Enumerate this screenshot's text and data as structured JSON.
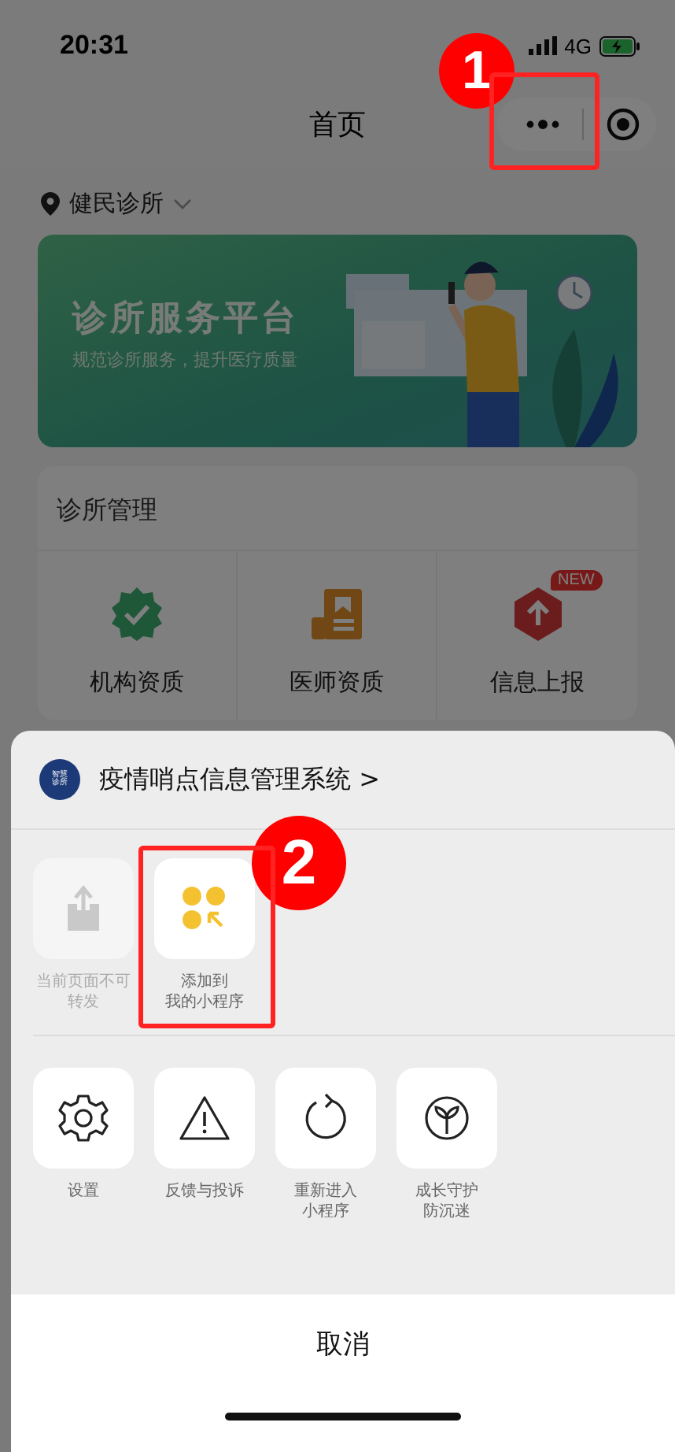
{
  "status_bar": {
    "time": "20:31",
    "network": "4G"
  },
  "nav_bar": {
    "title": "首页"
  },
  "location": {
    "name": "健民诊所"
  },
  "banner": {
    "title": "诊所服务平台",
    "subtitle": "规范诊所服务，提升医疗质量"
  },
  "clinic_card": {
    "title": "诊所管理",
    "items": [
      {
        "kind": "verify",
        "label": "机构资质"
      },
      {
        "kind": "doctor",
        "label": "医师资质"
      },
      {
        "kind": "report",
        "label": "信息上报",
        "badge": "NEW"
      }
    ]
  },
  "sheet": {
    "app_name": "疫情哨点信息管理系统",
    "app_arrow": ">",
    "logo_text": [
      "智慧",
      "诊所"
    ],
    "row_1": [
      {
        "kind": "share",
        "label": [
          "当前页面不可",
          "转发"
        ],
        "disabled": true
      },
      {
        "kind": "add",
        "label": [
          "添加到",
          "我的小程序"
        ],
        "disabled": false
      }
    ],
    "row_2": [
      {
        "kind": "settings",
        "label": [
          "设置"
        ]
      },
      {
        "kind": "feedback",
        "label": [
          "反馈与投诉"
        ]
      },
      {
        "kind": "restart",
        "label": [
          "重新进入",
          "小程序"
        ]
      },
      {
        "kind": "growth",
        "label": [
          "成长守护",
          "防沉迷"
        ]
      }
    ],
    "cancel": "取消"
  },
  "annotations": [
    {
      "label": "1"
    },
    {
      "label": "2"
    }
  ]
}
